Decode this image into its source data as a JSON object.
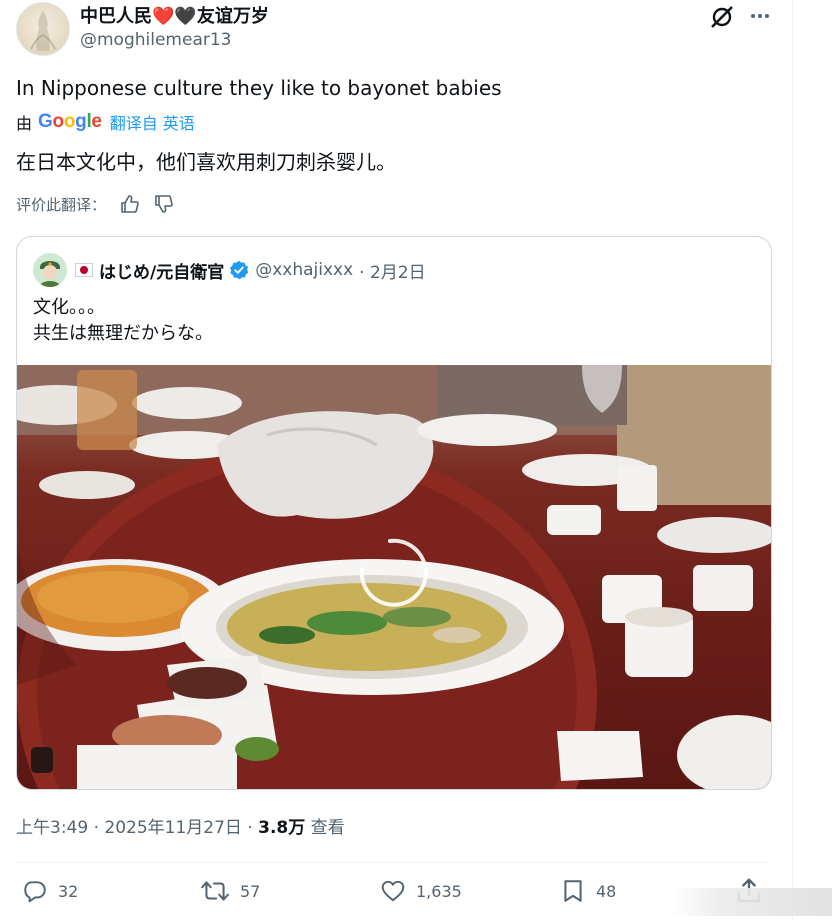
{
  "author": {
    "display_name": "中巴人民❤️🖤友谊万岁",
    "handle": "@moghilemear13"
  },
  "tweet": {
    "text": "In Nipponese culture they like to bayonet babies"
  },
  "translation": {
    "by_label": "由",
    "google_word": [
      "G",
      "o",
      "o",
      "g",
      "l",
      "e"
    ],
    "google_colors": [
      "#4285F4",
      "#EA4335",
      "#FBBC05",
      "#4285F4",
      "#34A853",
      "#EA4335"
    ],
    "link_label": "翻译自 英语",
    "translated_text": "在日本文化中，他们喜欢用刺刀刺杀婴儿。",
    "rate_label": "评价此翻译："
  },
  "quoted_post": {
    "display_name": "はじめ/元自衛官",
    "handle": "@xxhajixxx",
    "date": "· 2月2日",
    "line1": "文化。。。",
    "line2": "共生は無理だからな。"
  },
  "meta": {
    "time_date": "上午3:49 · 2025年11月27日 · ",
    "views": "3.8万",
    "views_label": " 查看"
  },
  "actions": {
    "replies": "32",
    "reposts": "57",
    "likes": "1,635",
    "bookmarks": "48"
  },
  "colors": {
    "link_blue": "#1d9bf0",
    "secondary_text": "#536471",
    "verified_blue": "#1d9bf0"
  }
}
